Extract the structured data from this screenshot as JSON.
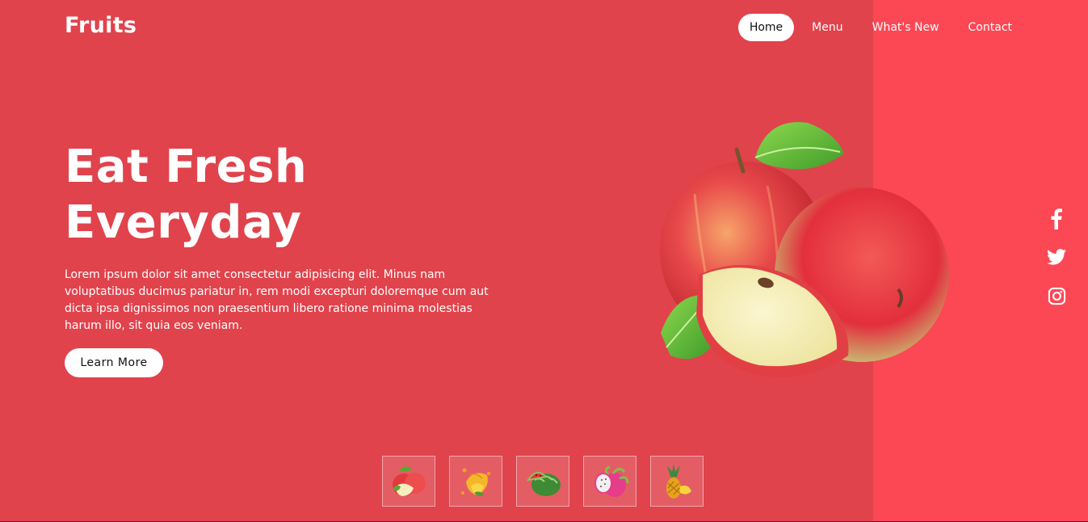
{
  "brand": {
    "logo": "Fruits"
  },
  "nav": {
    "items": [
      {
        "label": "Home",
        "active": true
      },
      {
        "label": "Menu",
        "active": false
      },
      {
        "label": "What's New",
        "active": false
      },
      {
        "label": "Contact",
        "active": false
      }
    ]
  },
  "hero": {
    "title_line1": "Eat Fresh",
    "title_line2": "Everyday",
    "description": "Lorem ipsum dolor sit amet consectetur adipisicing elit. Minus nam voluptatibus ducimus pariatur in, rem modi excepturi doloremque cum aut dicta ipsa dignissimos non praesentium libero ratione minima molestias harum illo, sit quia eos veniam.",
    "cta_label": "Learn More",
    "image": "apple-image"
  },
  "social": {
    "icons": [
      "facebook-icon",
      "twitter-icon",
      "instagram-icon"
    ]
  },
  "thumbnails": [
    "apple-thumbnail",
    "mango-thumbnail",
    "watermelon-thumbnail",
    "dragon-fruit-thumbnail",
    "pineapple-thumbnail"
  ],
  "colors": {
    "background_main": "#e0434c",
    "background_side": "#fc4754",
    "button_bg": "#ffffff",
    "text": "#ffffff"
  }
}
